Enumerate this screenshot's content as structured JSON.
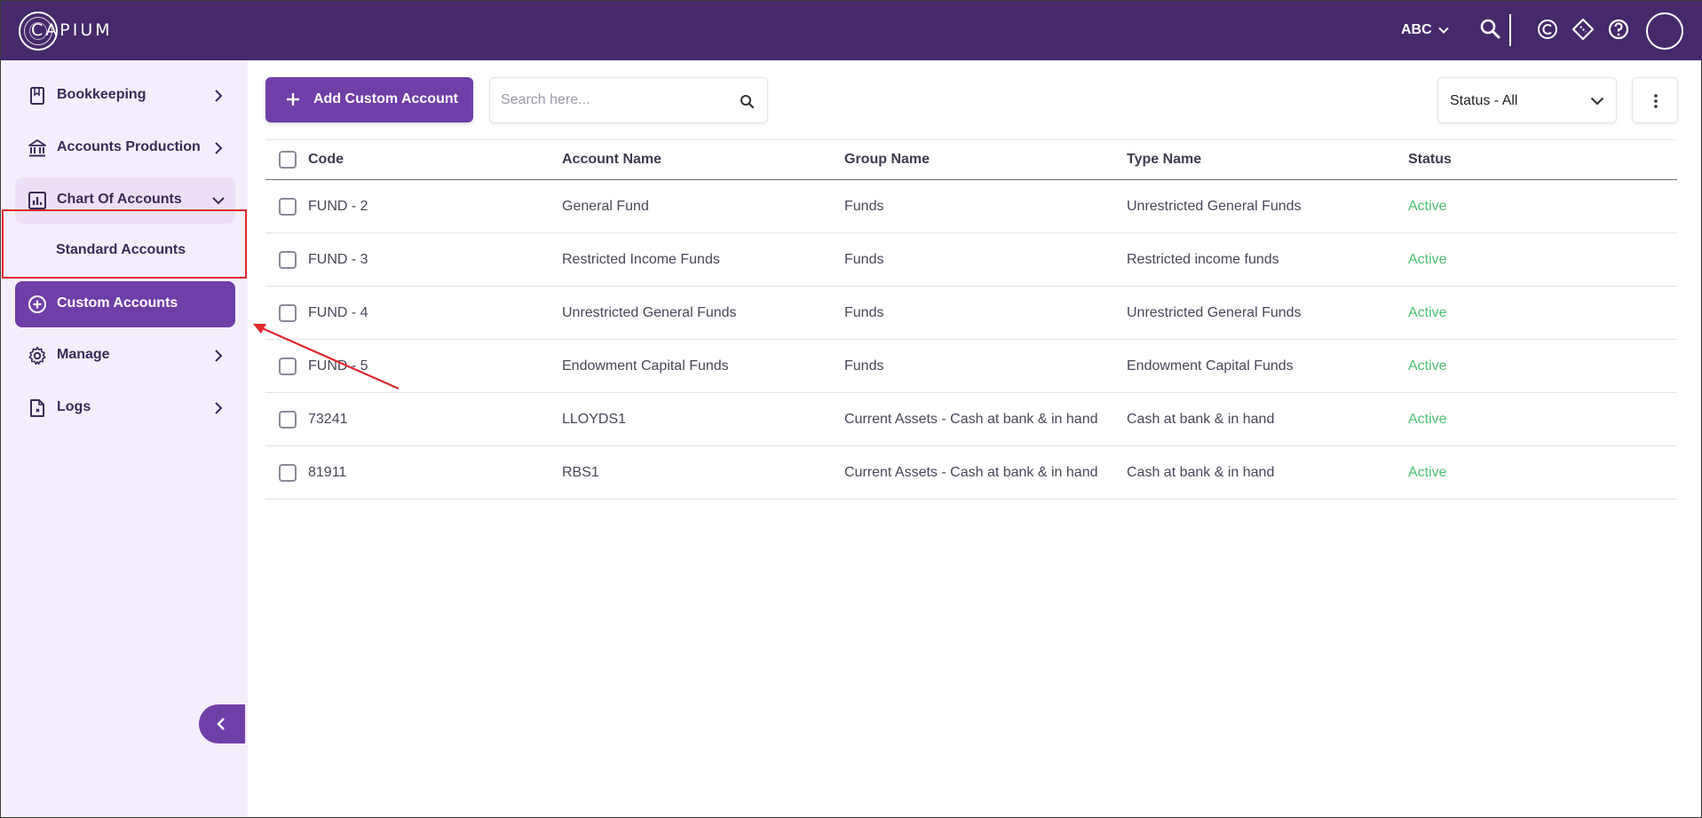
{
  "app": {
    "logo_text": "CAPIUM"
  },
  "header": {
    "org": "ABC"
  },
  "sidebar": {
    "items": [
      {
        "label": "Bookkeeping",
        "icon": "book-icon"
      },
      {
        "label": "Accounts Production",
        "icon": "bank-icon"
      },
      {
        "label": "Chart Of Accounts",
        "icon": "chart-icon"
      },
      {
        "label": "Standard Accounts"
      },
      {
        "label": "Custom Accounts",
        "icon": "add-circle-icon"
      },
      {
        "label": "Manage",
        "icon": "gear-icon"
      },
      {
        "label": "Logs",
        "icon": "log-file-icon"
      }
    ]
  },
  "toolbar": {
    "add_label": "Add Custom Account",
    "search_placeholder": "Search here...",
    "status_filter": "Status - All"
  },
  "table": {
    "headers": [
      "Code",
      "Account Name",
      "Group Name",
      "Type Name",
      "Status"
    ],
    "rows": [
      [
        "FUND - 2",
        "General Fund",
        "Funds",
        "Unrestricted General Funds",
        "Active"
      ],
      [
        "FUND - 3",
        "Restricted Income Funds",
        "Funds",
        "Restricted income funds",
        "Active"
      ],
      [
        "FUND - 4",
        "Unrestricted General Funds",
        "Funds",
        "Unrestricted General Funds",
        "Active"
      ],
      [
        "FUND - 5",
        "Endowment Capital Funds",
        "Funds",
        "Endowment Capital Funds",
        "Active"
      ],
      [
        "73241",
        "LLOYDS1",
        "Current Assets - Cash at bank & in hand",
        "Cash at bank & in hand",
        "Active"
      ],
      [
        "81911",
        "RBS1",
        "Current Assets - Cash at bank & in hand",
        "Cash at bank & in hand",
        "Active"
      ]
    ]
  },
  "colors": {
    "header_bg": "#46296b",
    "accent": "#6f3fa8",
    "sidebar_bg": "#f4eefc",
    "status_active": "#4cbf72",
    "annotation": "#e0282e"
  }
}
